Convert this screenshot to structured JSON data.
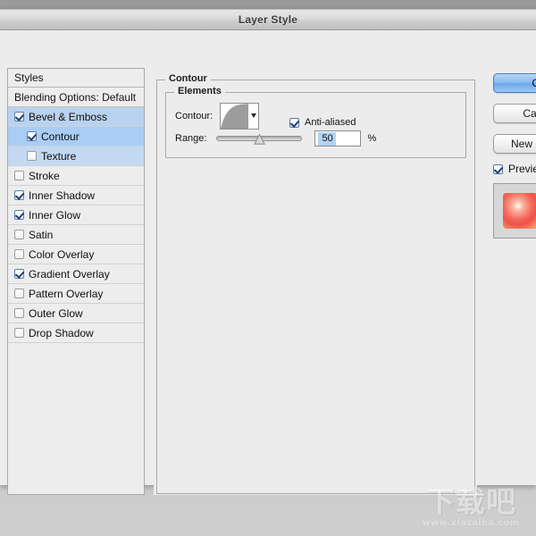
{
  "window": {
    "title": "Layer Style"
  },
  "sidebar": {
    "header": "Styles",
    "blending_options": "Blending Options: Default",
    "items": [
      {
        "label": "Bevel & Emboss",
        "checked": true,
        "sub": false,
        "state": "parent-selected"
      },
      {
        "label": "Contour",
        "checked": true,
        "sub": true,
        "state": "selected"
      },
      {
        "label": "Texture",
        "checked": false,
        "sub": true,
        "state": "child"
      },
      {
        "label": "Stroke",
        "checked": false,
        "sub": false,
        "state": "normal"
      },
      {
        "label": "Inner Shadow",
        "checked": true,
        "sub": false,
        "state": "normal"
      },
      {
        "label": "Inner Glow",
        "checked": true,
        "sub": false,
        "state": "normal"
      },
      {
        "label": "Satin",
        "checked": false,
        "sub": false,
        "state": "normal"
      },
      {
        "label": "Color Overlay",
        "checked": false,
        "sub": false,
        "state": "normal"
      },
      {
        "label": "Gradient Overlay",
        "checked": true,
        "sub": false,
        "state": "normal"
      },
      {
        "label": "Pattern Overlay",
        "checked": false,
        "sub": false,
        "state": "normal"
      },
      {
        "label": "Outer Glow",
        "checked": false,
        "sub": false,
        "state": "normal"
      },
      {
        "label": "Drop Shadow",
        "checked": false,
        "sub": false,
        "state": "normal"
      }
    ]
  },
  "panel": {
    "group_title": "Contour",
    "elements_title": "Elements",
    "contour_label": "Contour:",
    "contour_preset": "contour-curve-thumbnail",
    "antialiased_label": "Anti-aliased",
    "antialiased_checked": true,
    "range_label": "Range:",
    "range_value": "50",
    "range_percent_sign": "%",
    "range_slider_position": 50
  },
  "buttons": {
    "ok": "OK",
    "cancel": "Cancel",
    "new_style": "New Style...",
    "preview_label": "Preview",
    "preview_checked": true
  },
  "watermark": {
    "glyphs": "下载吧",
    "url": "www.xiazaiba.com"
  },
  "colors": {
    "selection_blue": "#a9cdf5",
    "parent_blue": "#b9d2ef",
    "child_blue": "#c3d9f2",
    "default_button_blue": "#86baf0",
    "field_highlight": "#b2d2f2",
    "preview_swatch": "#f4685a"
  }
}
